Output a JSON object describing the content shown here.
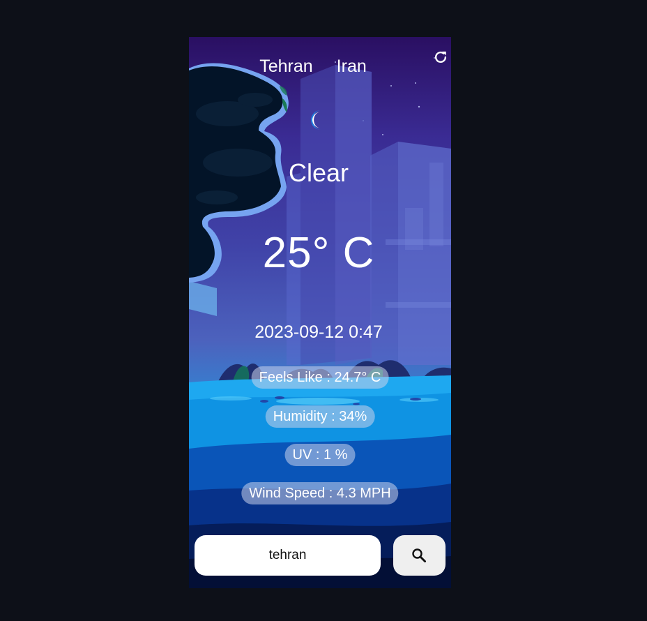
{
  "location": {
    "city": "Tehran",
    "country": "Iran"
  },
  "icons": {
    "refresh": "refresh-icon",
    "weather": "crescent-moon-icon",
    "search": "search-icon"
  },
  "weather": {
    "condition": "Clear",
    "temperature": "25° C",
    "datetime": "2023-09-12 0:47"
  },
  "details": {
    "feels_like": "Feels Like : 24.7° C",
    "humidity": "Humidity : 34%",
    "uv": "UV : 1 %",
    "wind_speed": "Wind Speed : 4.3 MPH"
  },
  "search": {
    "value": "tehran"
  },
  "colors": {
    "page_background": "#0d1018",
    "sky_top": "#2a0f62",
    "sky_mid": "#4043a8",
    "water": "#0f98e6",
    "deep_water": "#041239",
    "pill_background": "rgba(200,210,235,0.55)",
    "text": "#ffffff"
  }
}
